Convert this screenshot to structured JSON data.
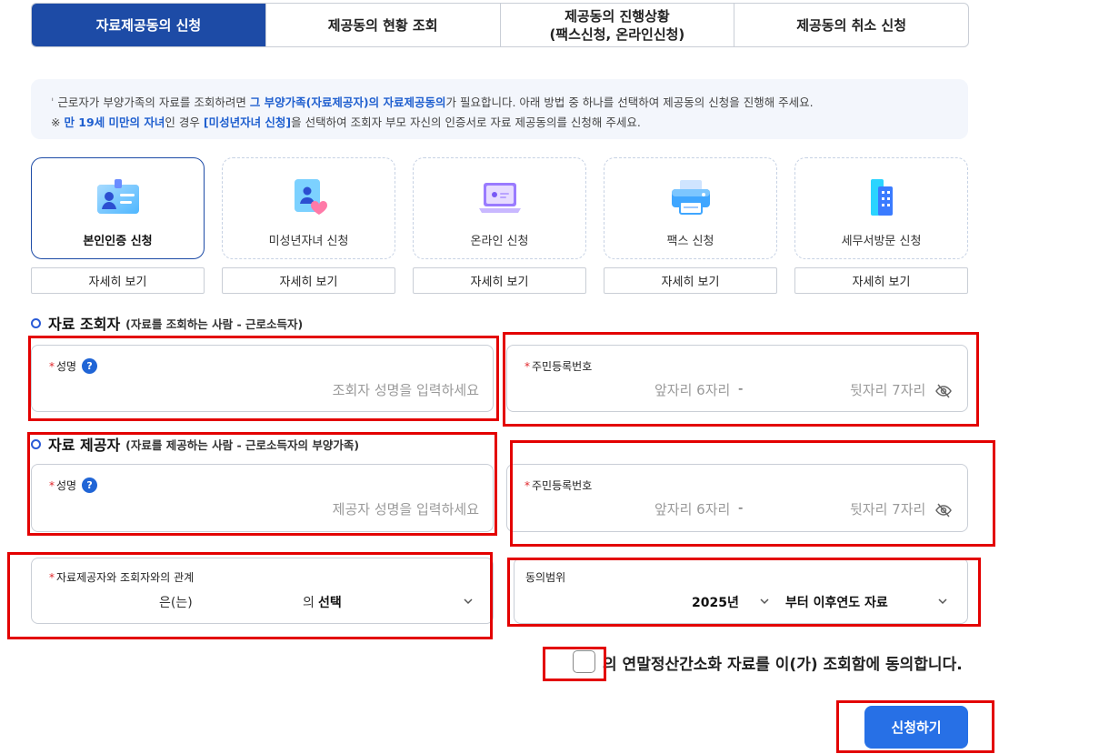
{
  "tabs": [
    {
      "line1": "자료제공동의 신청",
      "line2": ""
    },
    {
      "line1": "제공동의 현황 조회",
      "line2": ""
    },
    {
      "line1": "제공동의 진행상황",
      "line2": "(팩스신청, 온라인신청)"
    },
    {
      "line1": "제공동의 취소 신청",
      "line2": ""
    }
  ],
  "info": {
    "line1_a": "근로자가 부양가족의 자료를 조회하려면 ",
    "line1_hl": "그 부양가족(자료제공자)의 자료제공동의",
    "line1_b": "가 필요합니다. 아래 방법 중 하나를 선택하여 제공동의 신청을 진행해 주세요.",
    "line2_a": "※ ",
    "line2_hl1": "만 19세 미만의 자녀",
    "line2_b": "인 경우 ",
    "line2_hl2": "[미성년자녀 신청]",
    "line2_c": "을 선택하여 조회자 부모 자신의 인증서로 자료 제공동의를 신청해 주세요."
  },
  "methods": [
    {
      "label": "본인인증 신청",
      "icon": "id-card-icon",
      "detail": "자세히 보기"
    },
    {
      "label": "미성년자녀 신청",
      "icon": "child-card-icon",
      "detail": "자세히 보기"
    },
    {
      "label": "온라인 신청",
      "icon": "laptop-icon",
      "detail": "자세히 보기"
    },
    {
      "label": "팩스 신청",
      "icon": "fax-icon",
      "detail": "자세히 보기"
    },
    {
      "label": "세무서방문 신청",
      "icon": "building-icon",
      "detail": "자세히 보기"
    }
  ],
  "viewer": {
    "title": "자료 조회자",
    "subtitle": "(자료를 조회하는 사람 - 근로소득자)",
    "name_label": "성명",
    "name_placeholder": "조회자 성명을 입력하세요",
    "rrn_label": "주민등록번호",
    "rrn_front_placeholder": "앞자리 6자리",
    "rrn_dash": "-",
    "rrn_back_placeholder": "뒷자리 7자리"
  },
  "provider": {
    "title": "자료 제공자",
    "subtitle": "(자료를 제공하는 사람 - 근로소득자의 부양가족)",
    "name_label": "성명",
    "name_placeholder": "제공자 성명을 입력하세요",
    "rrn_label": "주민등록번호",
    "rrn_front_placeholder": "앞자리 6자리",
    "rrn_dash": "-",
    "rrn_back_placeholder": "뒷자리 7자리"
  },
  "relation": {
    "label": "자료제공자와 조회자와의 관계",
    "prefix": "은(는)",
    "middle": "의",
    "value": "선택"
  },
  "scope": {
    "label": "동의범위",
    "year": "2025년",
    "range": "부터 이후연도 자료"
  },
  "agree_text": "의 연말정산간소화 자료를 이(가) 조회함에 동의합니다.",
  "submit": "신청하기",
  "colors": {
    "primary": "#1d4ba6",
    "button": "#2770e6",
    "highlight": "#1f5fcf",
    "required": "#e0262b",
    "annotation": "#e30000"
  }
}
